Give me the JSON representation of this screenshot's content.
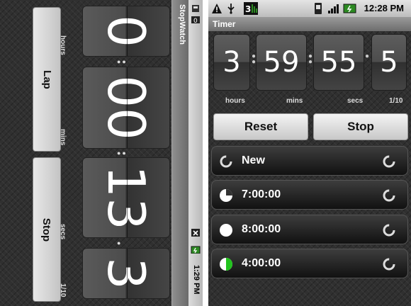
{
  "stopwatch": {
    "title": "StopWatch",
    "status_time": "1:29 PM",
    "digits": {
      "hours": "0",
      "mins": "00",
      "secs": "13",
      "tenths": "3"
    },
    "units": {
      "hours": "hours",
      "mins": "mins",
      "secs": "secs",
      "tenths": "1/10"
    },
    "buttons": {
      "lap": "Lap",
      "stop": "Stop"
    }
  },
  "timer": {
    "title": "Timer",
    "status_time": "12:28 PM",
    "digits": {
      "hours": "3",
      "mins": "59",
      "secs": "55",
      "tenths": "5"
    },
    "units": {
      "hours": "hours",
      "mins": "mins",
      "secs": "secs",
      "tenths": "1/10"
    },
    "buttons": {
      "reset": "Reset",
      "stop": "Stop"
    },
    "presets": [
      {
        "label": "New",
        "progress": 0
      },
      {
        "label": "7:00:00",
        "progress": 0.25
      },
      {
        "label": "8:00:00",
        "progress": 0
      },
      {
        "label": "4:00:00",
        "progress": 0.5
      }
    ]
  },
  "colors": {
    "accent_green": "#22c41e",
    "text_light": "#ffffff"
  }
}
